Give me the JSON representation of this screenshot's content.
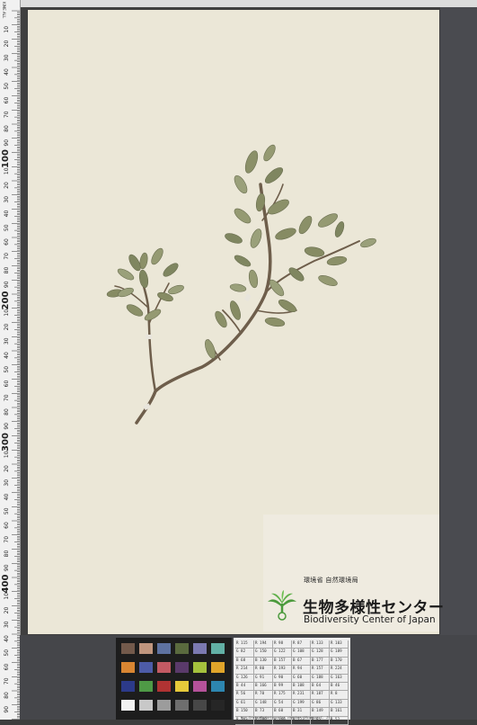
{
  "ruler": {
    "caption": "KIME ALL",
    "labels": [
      "10",
      "20",
      "30",
      "40",
      "50",
      "60",
      "70",
      "80",
      "90",
      "100",
      "10",
      "20",
      "30",
      "40",
      "50",
      "60",
      "70",
      "80",
      "90",
      "200",
      "10",
      "20",
      "30",
      "40",
      "50",
      "60",
      "70",
      "80",
      "90",
      "300",
      "10",
      "20",
      "30",
      "40",
      "50",
      "60",
      "70",
      "80",
      "90",
      "400",
      "10",
      "20",
      "30",
      "40",
      "50",
      "60",
      "70",
      "80",
      "90",
      "500"
    ]
  },
  "label": {
    "ministry": "環境省 自然環境局",
    "japanese_name": "生物多様性センター",
    "english_name": "Biodiversity Center of Japan"
  },
  "color_card": {
    "swatches": [
      "#735a4b",
      "#c0967e",
      "#5e72a0",
      "#5a6a3e",
      "#7b79b0",
      "#62b0a5",
      "#d98632",
      "#4d5ba7",
      "#c25a63",
      "#5a3a6a",
      "#a4c13d",
      "#e0a52a",
      "#2c3a8a",
      "#4f9a46",
      "#b03333",
      "#e6c93a",
      "#b5529a",
      "#2d86b0",
      "#f2f2f2",
      "#c8c8c8",
      "#9c9c9c",
      "#6e6e6e",
      "#474747",
      "#262626"
    ]
  },
  "reference_card": {
    "rows": [
      [
        "R 115",
        "R 194",
        "R 98",
        "R 87",
        "R 133",
        "R 103"
      ],
      [
        "G 82",
        "G 150",
        "G 122",
        "G 108",
        "G 128",
        "G 189"
      ],
      [
        "B 68",
        "B 130",
        "B 157",
        "B 67",
        "B 177",
        "B 170"
      ],
      [
        "R 214",
        "R 80",
        "R 193",
        "R 94",
        "R 157",
        "R 224"
      ],
      [
        "G 126",
        "G 91",
        "G 90",
        "G 60",
        "G 188",
        "G 163"
      ],
      [
        "B 44",
        "B 166",
        "B 99",
        "B 108",
        "B 64",
        "B 46"
      ],
      [
        "R 56",
        "R 70",
        "R 175",
        "R 231",
        "R 187",
        "R 8"
      ],
      [
        "G 61",
        "G 148",
        "G 54",
        "G 199",
        "G 86",
        "G 133"
      ],
      [
        "B 150",
        "B 73",
        "B 60",
        "B 31",
        "B 149",
        "B 161"
      ],
      [
        "R 243",
        "R 200",
        "R 160",
        "R 122",
        "R 85",
        "R 52"
      ]
    ],
    "note": "by: GretagMacbeth color checker (Mcamson C. 2¹)"
  },
  "colors": {
    "sheet": "#ebe7d7",
    "leaf": "#8a9068",
    "stem": "#6f5f4c"
  }
}
